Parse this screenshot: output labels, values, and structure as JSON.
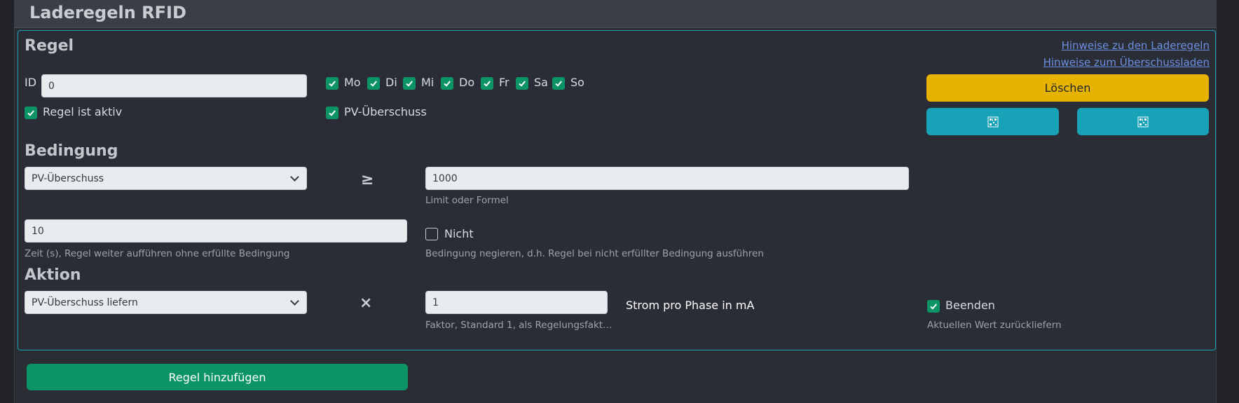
{
  "card": {
    "title": "Laderegeln RFID"
  },
  "rule": {
    "heading": "Regel",
    "links": {
      "hints_rules": "Hinweise zu den Laderegeln",
      "hints_surplus": "Hinweise zum Überschussladen"
    },
    "id_label": "ID",
    "id_value": "0",
    "days": [
      {
        "label": "Mo",
        "checked": true
      },
      {
        "label": "Di",
        "checked": true
      },
      {
        "label": "Mi",
        "checked": true
      },
      {
        "label": "Do",
        "checked": true
      },
      {
        "label": "Fr",
        "checked": true
      },
      {
        "label": "Sa",
        "checked": true
      },
      {
        "label": "So",
        "checked": true
      }
    ],
    "active_label": "Regel ist aktiv",
    "active_checked": true,
    "pv_label": "PV-Überschuss",
    "pv_checked": true,
    "delete_label": "Löschen",
    "icon_button_left": "qr-icon",
    "icon_button_right": "qr-icon"
  },
  "condition": {
    "heading": "Bedingung",
    "select_value": "PV-Überschuss",
    "operator": "≥",
    "limit_value": "1000",
    "limit_hint": "Limit oder Formel",
    "time_value": "10",
    "time_hint": "Zeit (s), Regel weiter aufführen ohne erfüllte Bedingung",
    "not_label": "Nicht",
    "not_checked": false,
    "not_hint": "Bedingung negieren, d.h. Regel bei nicht erfüllter Bedingung ausführen"
  },
  "action": {
    "heading": "Aktion",
    "select_value": "PV-Überschuss liefern",
    "operator": "×",
    "factor_value": "1",
    "factor_hint": "Faktor, Standard 1, als Regelungsfakt…",
    "unit_label": "Strom pro Phase in mA",
    "end_label": "Beenden",
    "end_checked": true,
    "end_hint": "Aktuellen Wert zurückliefern"
  },
  "add_rule_label": "Regel hinzufügen",
  "colors": {
    "accent_border": "#16a2b8",
    "check_green": "#0c9466",
    "warning": "#e6b400",
    "info": "#17a2b8",
    "success": "#0c9466"
  }
}
